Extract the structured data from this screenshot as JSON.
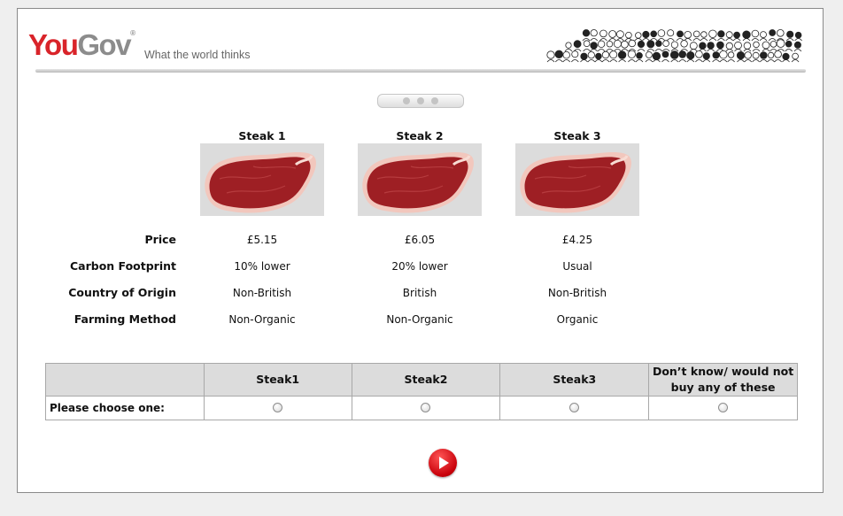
{
  "brand": {
    "logo_you": "You",
    "logo_gov": "Gov",
    "logo_mark": "®",
    "tagline": "What the world thinks"
  },
  "steaks": [
    {
      "title": "Steak 1",
      "price": "£5.15",
      "carbon": "10% lower",
      "origin": "Non-British",
      "farming": "Non-Organic"
    },
    {
      "title": "Steak 2",
      "price": "£6.05",
      "carbon": "20% lower",
      "origin": "British",
      "farming": "Non-Organic"
    },
    {
      "title": "Steak 3",
      "price": "£4.25",
      "carbon": "Usual",
      "origin": "Non-British",
      "farming": "Organic"
    }
  ],
  "attributes": {
    "price": "Price",
    "carbon": "Carbon Footprint",
    "origin": "Country of Origin",
    "farming": "Farming Method"
  },
  "choice": {
    "columns": [
      "Steak1",
      "Steak2",
      "Steak3",
      "Don’t know/ would not buy any of these"
    ],
    "prompt": "Please choose one:"
  },
  "colors": {
    "brand_red": "#d9242a",
    "brand_gray": "#8c8c8c",
    "header_gray": "#dcdcdc",
    "next_button": "#c8000a"
  },
  "icons": {
    "next": "play-arrow-icon",
    "crowd": "crowd-illustration",
    "steak": "raw-steak-image"
  }
}
